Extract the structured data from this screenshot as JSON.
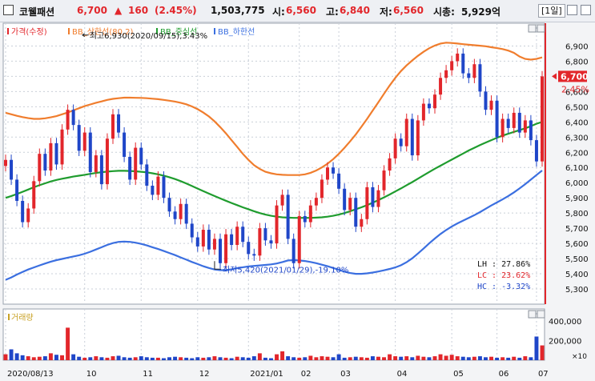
{
  "header": {
    "name": "코웰패션",
    "price": "6,700",
    "change_arrow": "▲",
    "change": "160",
    "change_pct": "(2.45%)",
    "volume": "1,503,775",
    "open_label": "시:",
    "open": "6,560",
    "high_label": "고:",
    "high": "6,840",
    "low_label": "저:",
    "low": "6,560",
    "mcap_label": "시총:",
    "mcap": "5,929억",
    "period": "[1일]"
  },
  "colors": {
    "up": "#e2262b",
    "down": "#1f46c8",
    "upper_band": "#f07d2d",
    "middle_band": "#1f9c2e",
    "lower_band": "#3b6fe0",
    "grid": "#c9cfd8",
    "background": "#ffffff"
  },
  "chart_data": [
    {
      "type": "line",
      "legend": [
        "가격(수정)",
        "BB_상한선(80,2)",
        "BB_중심선",
        "BB_하한선"
      ],
      "x_ticks": [
        "2020/08/13",
        "10",
        "11",
        "12",
        "2021/01",
        "02",
        "03",
        "04",
        "05",
        "06",
        "07"
      ],
      "y_ticks": [
        "6,900",
        "6,800",
        "6,700",
        "6,600",
        "6,500",
        "6,400",
        "6,300",
        "6,200",
        "6,100",
        "6,000",
        "5,900",
        "5,800",
        "5,700",
        "5,600",
        "5,500",
        "5,400",
        "5,300"
      ],
      "ylim": [
        5200,
        7050
      ],
      "y_values": [
        6900,
        6800,
        6700,
        6600,
        6500,
        6400,
        6300,
        6200,
        6100,
        6000,
        5900,
        5800,
        5700,
        5600,
        5500,
        5400,
        5300
      ],
      "current_price_label": "6,700",
      "current_pct_label": "2.45%",
      "current_price": 6700,
      "grid": true,
      "annotations": {
        "high": "최고6,930(2020/09/15),3.43%",
        "low": "최저5,420(2021/01/29),-19.10%",
        "lh": "LH : 27.86%",
        "lc": "LC : 23.62%",
        "hc": "HC : -3.32%"
      },
      "series": [
        {
          "name": "BB_상한선(80,2)",
          "values": [
            6460,
            6450,
            6440,
            6432,
            6425,
            6420,
            6420,
            6424,
            6430,
            6438,
            6450,
            6462,
            6476,
            6490,
            6504,
            6515,
            6526,
            6535,
            6545,
            6552,
            6556,
            6560,
            6560,
            6559,
            6558,
            6556,
            6553,
            6550,
            6545,
            6540,
            6534,
            6526,
            6516,
            6502,
            6484,
            6462,
            6436,
            6404,
            6366,
            6325,
            6280,
            6235,
            6190,
            6150,
            6115,
            6090,
            6072,
            6062,
            6055,
            6052,
            6050,
            6050,
            6050,
            6055,
            6065,
            6080,
            6100,
            6125,
            6155,
            6190,
            6230,
            6272,
            6318,
            6368,
            6420,
            6475,
            6530,
            6585,
            6640,
            6690,
            6735,
            6772,
            6805,
            6835,
            6862,
            6885,
            6903,
            6916,
            6922,
            6920,
            6916,
            6912,
            6908,
            6905,
            6902,
            6898,
            6892,
            6886,
            6880,
            6870,
            6855,
            6830,
            6815,
            6810,
            6815,
            6825
          ]
        },
        {
          "name": "BB_중심선",
          "values": [
            5900,
            5912,
            5925,
            5940,
            5955,
            5970,
            5983,
            5996,
            6008,
            6018,
            6026,
            6033,
            6040,
            6046,
            6052,
            6058,
            6064,
            6069,
            6073,
            6076,
            6078,
            6078,
            6077,
            6075,
            6072,
            6068,
            6062,
            6055,
            6046,
            6036,
            6024,
            6010,
            5995,
            5978,
            5961,
            5945,
            5928,
            5912,
            5896,
            5881,
            5866,
            5852,
            5838,
            5825,
            5812,
            5800,
            5790,
            5782,
            5776,
            5772,
            5770,
            5768,
            5768,
            5768,
            5768,
            5770,
            5772,
            5776,
            5782,
            5790,
            5800,
            5812,
            5825,
            5838,
            5852,
            5868,
            5885,
            5903,
            5922,
            5942,
            5962,
            5983,
            6004,
            6026,
            6048,
            6070,
            6092,
            6112,
            6132,
            6152,
            6172,
            6192,
            6212,
            6230,
            6248,
            6264,
            6280,
            6296,
            6310,
            6322,
            6334,
            6346,
            6358,
            6372,
            6388,
            6400
          ]
        },
        {
          "name": "BB_하한선",
          "values": [
            5360,
            5376,
            5395,
            5412,
            5428,
            5442,
            5455,
            5468,
            5480,
            5490,
            5498,
            5506,
            5514,
            5522,
            5532,
            5545,
            5560,
            5575,
            5590,
            5602,
            5610,
            5612,
            5610,
            5605,
            5597,
            5587,
            5575,
            5563,
            5550,
            5537,
            5523,
            5508,
            5493,
            5478,
            5464,
            5450,
            5438,
            5428,
            5424,
            5424,
            5430,
            5437,
            5443,
            5448,
            5452,
            5455,
            5458,
            5462,
            5468,
            5477,
            5488,
            5490,
            5488,
            5484,
            5478,
            5470,
            5460,
            5450,
            5438,
            5426,
            5414,
            5405,
            5400,
            5400,
            5403,
            5408,
            5415,
            5423,
            5432,
            5442,
            5456,
            5476,
            5502,
            5533,
            5566,
            5600,
            5632,
            5662,
            5688,
            5712,
            5732,
            5750,
            5768,
            5786,
            5806,
            5828,
            5850,
            5870,
            5890,
            5912,
            5936,
            5962,
            5990,
            6020,
            6050,
            6080
          ]
        },
        {
          "name": "가격(수정)",
          "values": [
            6150,
            6020,
            5880,
            5740,
            5830,
            6010,
            6190,
            6080,
            6260,
            6120,
            6350,
            6480,
            6380,
            6210,
            6330,
            6070,
            6180,
            5990,
            6290,
            6450,
            6330,
            6170,
            6020,
            6230,
            6120,
            5980,
            5920,
            6040,
            5900,
            5810,
            5760,
            5860,
            5730,
            5640,
            5580,
            5690,
            5560,
            5630,
            5470,
            5660,
            5590,
            5710,
            5610,
            5530,
            5520,
            5700,
            5620,
            5600,
            5850,
            5920,
            5630,
            5470,
            5780,
            5740,
            5850,
            5900,
            6020,
            6100,
            6060,
            5960,
            5820,
            5900,
            5710,
            5760,
            5970,
            5840,
            5950,
            6080,
            6160,
            6290,
            6240,
            6420,
            6180,
            6410,
            6520,
            6490,
            6580,
            6690,
            6740,
            6800,
            6850,
            6720,
            6690,
            6780,
            6600,
            6480,
            6540,
            6300,
            6420,
            6360,
            6460,
            6330,
            6410,
            6280,
            6140,
            6700
          ]
        }
      ]
    },
    {
      "type": "bar",
      "legend": [
        "거래량"
      ],
      "ylim": [
        0,
        520000
      ],
      "y_ticks": [
        "400,000",
        "200,000"
      ],
      "y_values": [
        400000,
        200000
      ],
      "unit_label": "×10",
      "values": [
        60000,
        110000,
        70000,
        50000,
        40000,
        30000,
        35000,
        40000,
        70000,
        55000,
        50000,
        330000,
        60000,
        35000,
        25000,
        30000,
        40000,
        30000,
        25000,
        40000,
        45000,
        30000,
        25000,
        30000,
        40000,
        30000,
        25000,
        25000,
        20000,
        30000,
        35000,
        30000,
        25000,
        20000,
        30000,
        25000,
        30000,
        40000,
        30000,
        25000,
        20000,
        35000,
        30000,
        25000,
        40000,
        70000,
        25000,
        20000,
        60000,
        90000,
        40000,
        30000,
        25000,
        30000,
        45000,
        30000,
        40000,
        35000,
        30000,
        60000,
        25000,
        30000,
        35000,
        30000,
        25000,
        40000,
        35000,
        30000,
        60000,
        40000,
        35000,
        40000,
        30000,
        45000,
        35000,
        30000,
        40000,
        60000,
        45000,
        55000,
        40000,
        35000,
        30000,
        35000,
        40000,
        30000,
        35000,
        25000,
        30000,
        25000,
        35000,
        25000,
        40000,
        30000,
        240000,
        150000
      ]
    }
  ]
}
